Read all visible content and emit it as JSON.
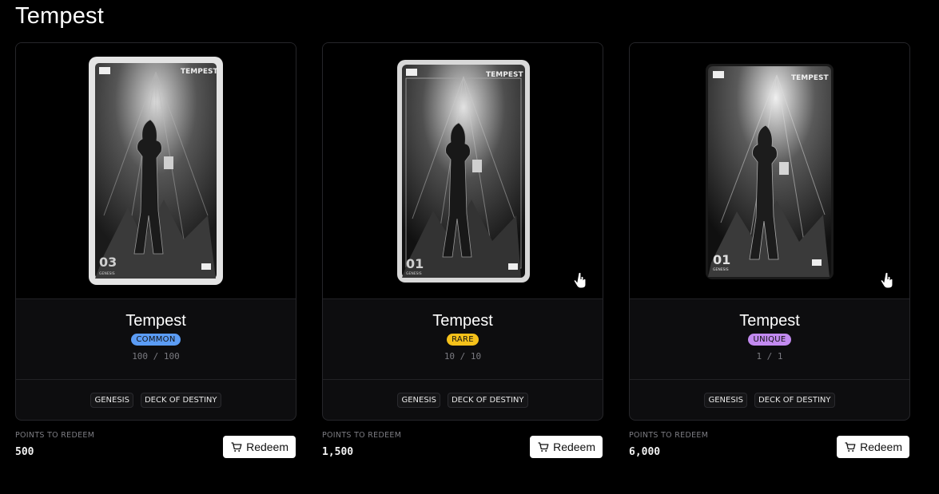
{
  "page": {
    "title": "Tempest"
  },
  "cards": [
    {
      "name": "Tempest",
      "rarity": "COMMON",
      "rarity_color": "#5b9cf5",
      "supply": "100 / 100",
      "tags": [
        "GENESIS",
        "DECK OF DESTINY"
      ],
      "points_label": "POINTS TO REDEEM",
      "points": "500",
      "redeem_label": "Redeem",
      "card_art": {
        "top_text": "TEMPEST",
        "number": "03",
        "sub": "GENESIS"
      }
    },
    {
      "name": "Tempest",
      "rarity": "RARE",
      "rarity_color": "#f5c11a",
      "supply": "10 / 10",
      "tags": [
        "GENESIS",
        "DECK OF DESTINY"
      ],
      "points_label": "POINTS TO REDEEM",
      "points": "1,500",
      "redeem_label": "Redeem",
      "card_art": {
        "top_text": "TEMPEST",
        "number": "01",
        "sub": "GENESIS"
      }
    },
    {
      "name": "Tempest",
      "rarity": "UNIQUE",
      "rarity_color": "#c28af0",
      "supply": "1 / 1",
      "tags": [
        "GENESIS",
        "DECK OF DESTINY"
      ],
      "points_label": "POINTS TO REDEEM",
      "points": "6,000",
      "redeem_label": "Redeem",
      "card_art": {
        "top_text": "TEMPEST",
        "number": "01",
        "sub": "GENESIS"
      }
    }
  ]
}
